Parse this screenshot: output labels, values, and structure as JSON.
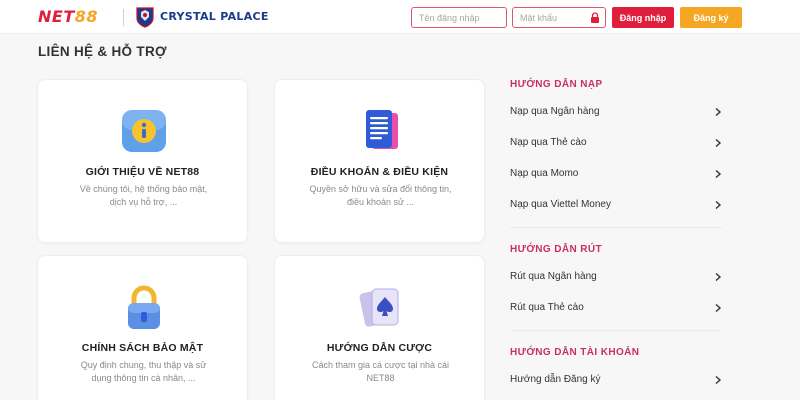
{
  "header": {
    "logo_prefix": "NET",
    "logo_suffix": "88",
    "partner_name": "CRYSTAL PALACE",
    "username_placeholder": "Tên đăng nhập",
    "password_placeholder": "Mật khẩu",
    "login_label": "Đăng nhập",
    "register_label": "Đăng ký"
  },
  "section": {
    "title": "LIÊN HỆ & HỖ TRỢ"
  },
  "cards": [
    {
      "title": "GIỚI THIỆU VỀ NET88",
      "desc": "Về chúng tôi, hệ thống bảo mật, dịch vụ hỗ trợ, ...",
      "icon": "info-icon"
    },
    {
      "title": "ĐIỀU KHOẢN & ĐIỀU KIỆN",
      "desc": "Quyền sở hữu và sửa đổi thông tin, điều khoản sử ...",
      "icon": "document-icon"
    },
    {
      "title": "CHÍNH SÁCH BẢO MẬT",
      "desc": "Quy định chung, thu thập và sử dụng thông tin cá nhân, ...",
      "icon": "padlock-icon"
    },
    {
      "title": "HƯỚNG DẪN CƯỢC",
      "desc": "Cách tham gia cá cược tại nhà cái NET88",
      "icon": "playing-cards-icon"
    }
  ],
  "sidebar": {
    "deposit": {
      "heading": "HƯỚNG DẪN NẠP",
      "items": [
        "Nạp qua Ngân hàng",
        "Nạp qua Thẻ cào",
        "Nạp qua Momo",
        "Nạp qua Viettel Money"
      ]
    },
    "withdraw": {
      "heading": "HƯỚNG DẪN RÚT",
      "items": [
        "Rút qua Ngân hàng",
        "Rút qua Thẻ cào"
      ]
    },
    "account": {
      "heading": "HƯỚNG DẪN TÀI KHOẢN",
      "items": [
        "Hướng dẫn Đăng ký"
      ]
    }
  },
  "colors": {
    "brand_red": "#e01e3c",
    "brand_orange": "#f5a623",
    "heading_pink": "#c9305f",
    "partner_blue": "#1b3a8c"
  }
}
